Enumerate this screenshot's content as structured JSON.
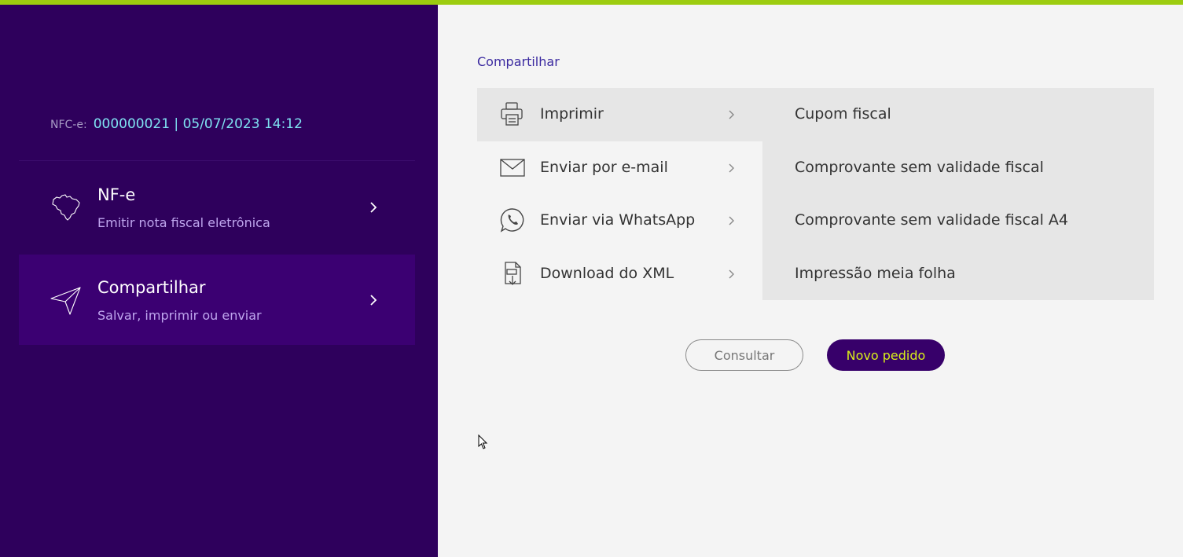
{
  "colors": {
    "accent_bar": "#9ccc0f",
    "sidebar_bg": "#2e005c",
    "sidebar_active": "#3b0072",
    "nfce_value": "#7fe2f2",
    "primary_button": "#37006a",
    "primary_button_text": "#d9ef18"
  },
  "sidebar": {
    "nfce": {
      "label": "NFC-e:",
      "value": "000000021 | 05/07/2023 14:12"
    },
    "items": [
      {
        "icon": "brazil-map-icon",
        "title": "NF-e",
        "subtitle": "Emitir nota fiscal eletrônica",
        "active": false
      },
      {
        "icon": "paper-plane-icon",
        "title": "Compartilhar",
        "subtitle": "Salvar, imprimir ou enviar",
        "active": true
      }
    ]
  },
  "main": {
    "title": "Compartilhar",
    "menu": [
      {
        "icon": "printer-icon",
        "label": "Imprimir",
        "active": true
      },
      {
        "icon": "envelope-icon",
        "label": "Enviar por e-mail",
        "active": false
      },
      {
        "icon": "whatsapp-icon",
        "label": "Enviar via WhatsApp",
        "active": false
      },
      {
        "icon": "xml-download-icon",
        "label": "Download do XML",
        "active": false
      }
    ],
    "print_options": [
      "Cupom fiscal",
      "Comprovante sem validade fiscal",
      "Comprovante sem validade fiscal A4",
      "Impressão meia folha"
    ],
    "buttons": {
      "consultar": "Consultar",
      "novo_pedido": "Novo pedido"
    }
  }
}
